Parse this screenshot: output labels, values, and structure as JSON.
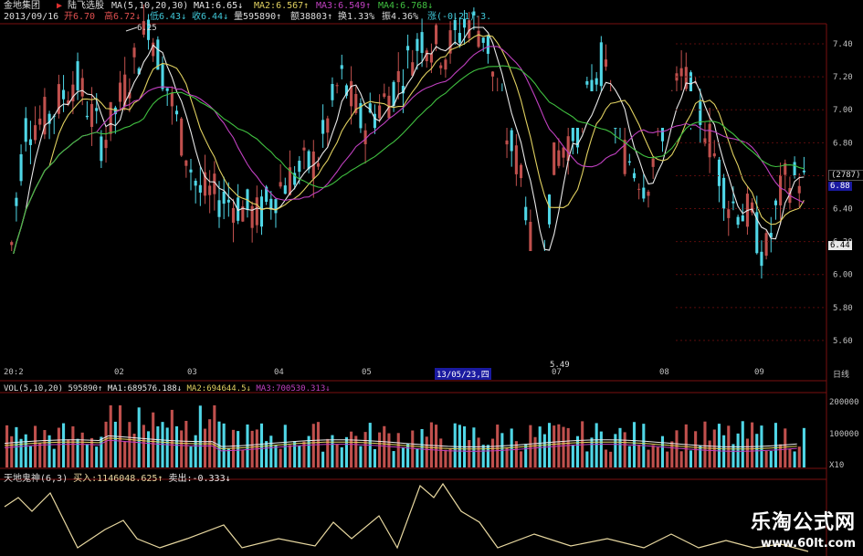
{
  "header": {
    "stock_name": "金地集团",
    "arrow": "▶",
    "tab": "陆飞选股",
    "ma_params": "MA(5,10,20,30)",
    "ma1": "MA1:6.65↓",
    "ma2": "MA2:6.567↑",
    "ma3": "MA3:6.549↑",
    "ma4": "MA4:6.768↓",
    "date": "2013/09/16",
    "open": "开6.70",
    "high": "高6.72↓",
    "low": "低6.43↓",
    "close": "收6.44↓",
    "volume": "量595890↑",
    "amount": "额38803↑",
    "turnover": "换1.33%",
    "amplitude": "振4.36%",
    "change": "涨(-0.21)-3."
  },
  "price_axis": {
    "ticks": [
      "7.40",
      "7.20",
      "7.00",
      "6.80",
      "6.60",
      "6.40",
      "6.20",
      "6.00",
      "5.80",
      "5.60"
    ],
    "box_code": "(2787)",
    "box_price": "6.88",
    "current_price": "6.44"
  },
  "annotations": {
    "high_label": "6.25",
    "low_label": "5.49"
  },
  "date_axis": {
    "labels": [
      "20:2",
      "02",
      "03",
      "04",
      "05",
      "13/05/23,四",
      "07",
      "08",
      "09"
    ],
    "right_label": "日线"
  },
  "volume_panel": {
    "title": "VOL(5,10,20)",
    "value": "595890↑",
    "ma1": "MA1:689576.188↓",
    "ma2": "MA2:694644.5↓",
    "ma3": "MA3:700530.313↓",
    "ticks": [
      "200000",
      "100000",
      "X10"
    ]
  },
  "indicator_panel": {
    "title": "天地鬼神(6,3)",
    "buy": "买入:1146048.625↑",
    "sell": "卖出:-0.333↓"
  },
  "colors": {
    "up": "#c0504d",
    "down": "#4fd6e6",
    "ma1": "#e8e8e8",
    "ma2": "#e0d060",
    "ma3": "#c040c0",
    "ma4": "#40c040",
    "grid": "#7a1010",
    "indicator": "#e8d8a0"
  },
  "watermark": {
    "title": "乐淘公式网",
    "url": "www.60lt.com"
  }
}
